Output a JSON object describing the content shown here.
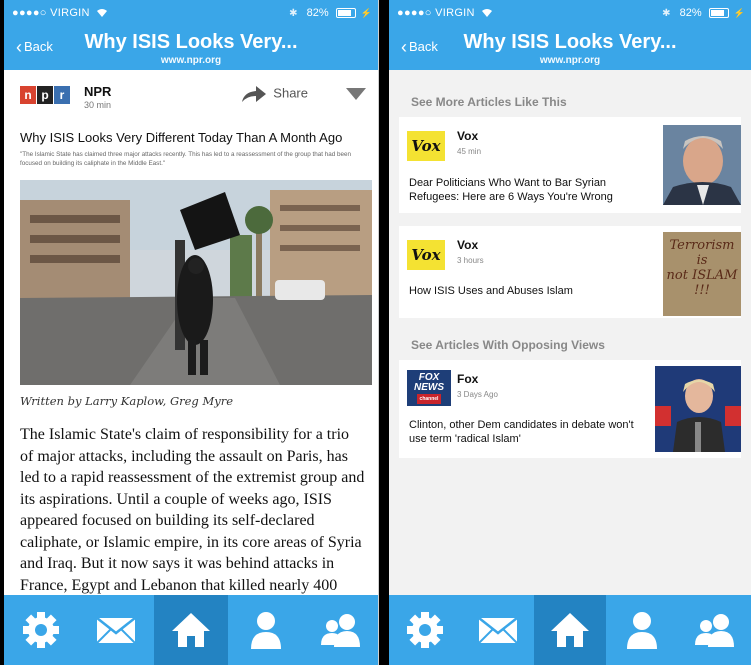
{
  "status_bar": {
    "carrier": "●●●●○ VIRGIN",
    "battery": "82%",
    "bluetooth": "✱",
    "charge": "⚡"
  },
  "left": {
    "header": {
      "back_label": "Back",
      "title": "Why ISIS Looks Very...",
      "subtitle": "www.npr.org"
    },
    "source": {
      "logo_letters": [
        "n",
        "p",
        "r"
      ],
      "name": "NPR",
      "time": "30 min",
      "share_label": "Share"
    },
    "article": {
      "headline": "Why ISIS Looks Very Different Today Than A Month Ago",
      "summary": "\"The Islamic State has claimed three major attacks recently. This has led to a reassessment of the group that had been focused on building its caliphate in the Middle East.\"",
      "byline": "Written by Larry Kaplow, Greg Myre",
      "body": "The Islamic State's claim of responsibility for a trio of major attacks, including the assault on Paris, has led to a rapid reassessment of the extremist group and its aspirations. Until a couple of weeks ago, ISIS appeared focused on building its self-declared caliphate, or Islamic empire, in its core areas of Syria and Iraq. But it now says it was behind attacks in France, Egypt and Lebanon that killed nearly 400"
    }
  },
  "right": {
    "header": {
      "back_label": "Back",
      "title": "Why ISIS Looks Very...",
      "subtitle": "www.npr.org"
    },
    "section_similar": "See More Articles Like This",
    "section_opposing": "See Articles With Opposing Views",
    "cards": [
      {
        "logo": "Vox",
        "source": "Vox",
        "time": "45 min",
        "text": "Dear Politicians Who Want to Bar Syrian Refugees: Here are 6 Ways You're Wrong"
      },
      {
        "logo": "Vox",
        "source": "Vox",
        "time": "3 hours",
        "text": "How ISIS Uses and Abuses Islam",
        "thumb_text": [
          "Terrorism",
          "is",
          "not ISLAM",
          "!!!"
        ]
      },
      {
        "logo_lines": [
          "FOX",
          "NEWS",
          "channel"
        ],
        "source": "Fox",
        "time": "3 Days Ago",
        "text": "Clinton, other Dem candidates in debate won't use term 'radical Islam'"
      }
    ]
  },
  "tabbar": {
    "icons": [
      "gear-icon",
      "mail-icon",
      "home-icon",
      "user-icon",
      "users-icon"
    ],
    "active": "home-icon"
  },
  "colors": {
    "accent": "#3aa6e8",
    "accent_dark": "#2383c2",
    "vox_yellow": "#f4e232",
    "fox_blue": "#1e3e78"
  }
}
